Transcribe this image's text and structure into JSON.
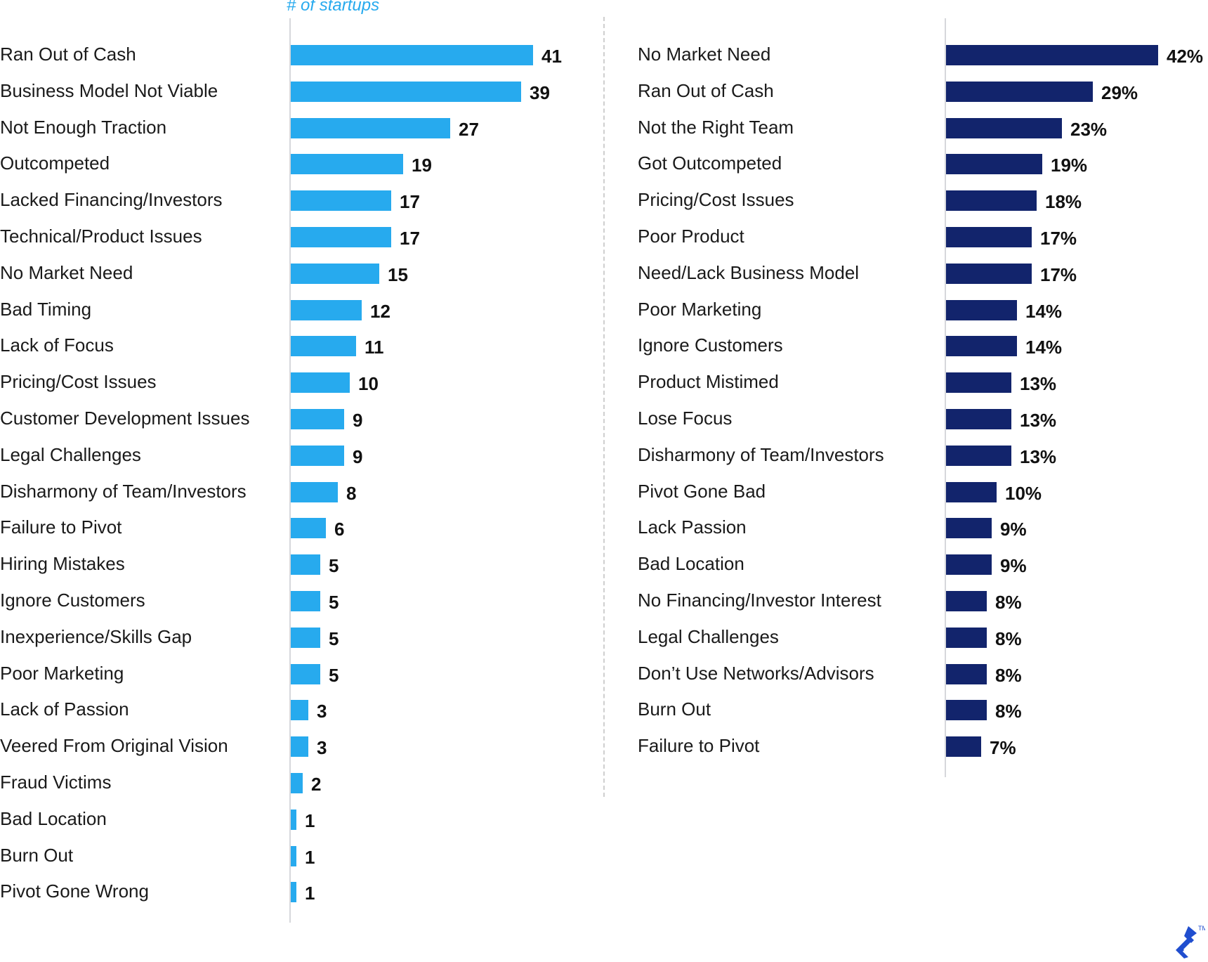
{
  "chart_data": [
    {
      "type": "bar",
      "orientation": "horizontal",
      "title": "",
      "xlabel": "# of startups",
      "ylabel": "",
      "bar_color": "#27aaee",
      "xlim": [
        0,
        41
      ],
      "grid": false,
      "categories": [
        "Ran Out of Cash",
        "Business Model Not Viable",
        "Not Enough Traction",
        "Outcompeted",
        "Lacked Financing/Investors",
        "Technical/Product Issues",
        "No Market Need",
        "Bad Timing",
        "Lack of Focus",
        "Pricing/Cost Issues",
        "Customer Development Issues",
        "Legal Challenges",
        "Disharmony of Team/Investors",
        "Failure to Pivot",
        "Hiring Mistakes",
        "Ignore Customers",
        "Inexperience/Skills Gap",
        "Poor Marketing",
        "Lack of Passion",
        "Veered From Original Vision",
        "Fraud Victims",
        "Bad Location",
        "Burn Out",
        "Pivot Gone Wrong"
      ],
      "values": [
        41,
        39,
        27,
        19,
        17,
        17,
        15,
        12,
        11,
        10,
        9,
        9,
        8,
        6,
        5,
        5,
        5,
        5,
        3,
        3,
        2,
        1,
        1,
        1
      ],
      "value_labels": [
        "41",
        "39",
        "27",
        "19",
        "17",
        "17",
        "15",
        "12",
        "11",
        "10",
        "9",
        "9",
        "8",
        "6",
        "5",
        "5",
        "5",
        "5",
        "3",
        "3",
        "2",
        "1",
        "1",
        "1"
      ]
    },
    {
      "type": "bar",
      "orientation": "horizontal",
      "title": "",
      "xlabel": "",
      "ylabel": "",
      "bar_color": "#12246c",
      "xlim": [
        0,
        42
      ],
      "grid": false,
      "categories": [
        "No Market Need",
        "Ran Out of Cash",
        "Not the Right Team",
        "Got Outcompeted",
        "Pricing/Cost Issues",
        "Poor Product",
        "Need/Lack Business Model",
        "Poor Marketing",
        "Ignore Customers",
        "Product Mistimed",
        "Lose Focus",
        "Disharmony of Team/Investors",
        "Pivot Gone Bad",
        "Lack Passion",
        "Bad Location",
        "No Financing/Investor Interest",
        "Legal Challenges",
        "Don’t Use Networks/Advisors",
        "Burn Out",
        "Failure to Pivot"
      ],
      "values": [
        42,
        29,
        23,
        19,
        18,
        17,
        17,
        14,
        14,
        13,
        13,
        13,
        10,
        9,
        9,
        8,
        8,
        8,
        8,
        7
      ],
      "value_labels": [
        "42%",
        "29%",
        "23%",
        "19%",
        "18%",
        "17%",
        "17%",
        "14%",
        "14%",
        "13%",
        "13%",
        "13%",
        "10%",
        "9%",
        "9%",
        "8%",
        "8%",
        "8%",
        "8%",
        "7%"
      ]
    }
  ],
  "axis_title": "# of startups",
  "colors": {
    "left_bars": "#27aaee",
    "right_bars": "#12246c",
    "axis_title": "#27aaee",
    "logo": "#204ecf"
  },
  "logo": {
    "icon": "toptal-logo-icon",
    "trademark": "TM"
  }
}
